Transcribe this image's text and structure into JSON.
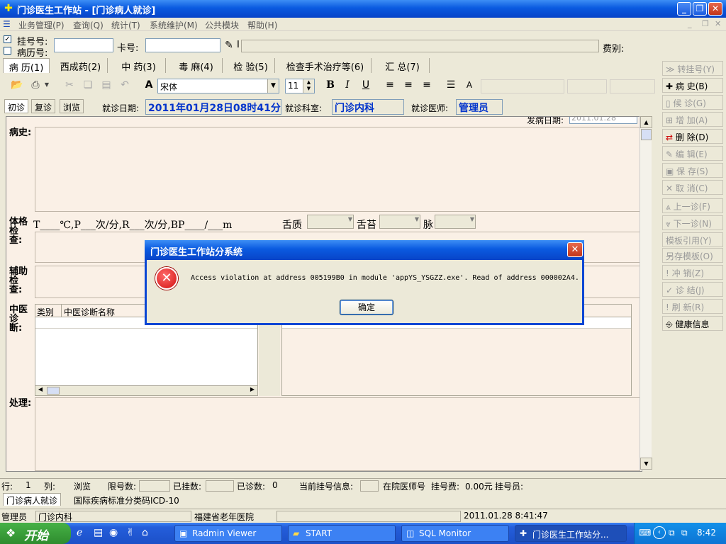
{
  "window": {
    "title": "门诊医生工作站 - [门诊病人就诊]"
  },
  "menu": {
    "items": [
      "业务管理(P)",
      "查询(Q)",
      "统计(T)",
      "系统维护(M)",
      "公共模块",
      "帮助(H)"
    ]
  },
  "registration": {
    "reg_no_label": "挂号号:",
    "record_no_label": "病历号:",
    "card_label": "卡号:",
    "fee_label": "费别:",
    "card_value": "I"
  },
  "tabs": [
    "病 历(1)",
    "西成药(2)",
    "中 药(3)",
    "毒 麻(4)",
    "检 验(5)",
    "检查手术治疗等(6)",
    "汇 总(7)"
  ],
  "toolbar": {
    "font_name": "宋体",
    "font_size": "11"
  },
  "visit": {
    "first": "初诊",
    "followup": "复诊",
    "browse": "浏览",
    "date_label": "就诊日期:",
    "date_value": "2011年01月28日08时41分",
    "dept_label": "就诊科室:",
    "dept_value": "门诊内科",
    "doctor_label": "就诊医师:",
    "doctor_value": "管理员"
  },
  "sections": {
    "history": "病史:",
    "exam": "体格检查:",
    "exam_line": "T____℃,P___次/分,R___次/分,BP____/___m",
    "tongue": "舌质",
    "coating": "舌苔",
    "pulse": "脉",
    "aux": "辅助检查:",
    "tcm": "中医诊断:",
    "treat": "处理:",
    "col_type": "类别",
    "col_name": "中医诊断名称",
    "onset": "发病日期:",
    "onset_value": "2011.01.28"
  },
  "right_panel": [
    {
      "label": "转挂号(Y)",
      "enabled": false
    },
    {
      "label": "病  史(B)",
      "enabled": true
    },
    {
      "label": "候  诊(G)",
      "enabled": false
    },
    {
      "label": "增  加(A)",
      "enabled": false
    },
    {
      "label": "删  除(D)",
      "enabled": true
    },
    {
      "label": "编  辑(E)",
      "enabled": false
    },
    {
      "label": "保  存(S)",
      "enabled": false
    },
    {
      "label": "取  消(C)",
      "enabled": false
    },
    {
      "label": "上一诊(F)",
      "enabled": false
    },
    {
      "label": "下一诊(N)",
      "enabled": false
    },
    {
      "label": "模板引用(Y)",
      "enabled": false
    },
    {
      "label": "另存模板(O)",
      "enabled": false
    },
    {
      "label": "冲  销(Z)",
      "enabled": false
    },
    {
      "label": "诊  结(J)",
      "enabled": false
    },
    {
      "label": "刷  新(R)",
      "enabled": false
    },
    {
      "label": "健康信息",
      "enabled": true
    }
  ],
  "status": {
    "row_label": "行:",
    "row_value": "1",
    "col_label": "列:",
    "browse": "浏览",
    "limit_label": "限号数:",
    "registered_label": "已挂数:",
    "seen_label": "已诊数:",
    "seen_value": "0",
    "current_reg_label": "当前挂号信息:",
    "ward_doctor_label": "在院医师号",
    "fee_label": "挂号费:",
    "fee_value": "0.00元",
    "clerk_label": "挂号员:"
  },
  "bottom_tabs": [
    "门诊病人就诊",
    "国际疾病标准分类码ICD-10"
  ],
  "footer": {
    "user": "管理员",
    "dept": "门诊内科",
    "hospital": "福建省老年医院",
    "datetime": "2011.01.28 8:41:47"
  },
  "taskbar": {
    "start": "开始",
    "tasks": [
      "Radmin Viewer",
      "START",
      "SQL Monitor",
      "门诊医生工作站分..."
    ],
    "clock": "8:42"
  },
  "dialog": {
    "title": "门诊医生工作站分系统",
    "message": "Access violation at address 005199B0 in module 'appYS_YSGZZ.exe'. Read of address 000002A4.",
    "ok": "确定"
  }
}
